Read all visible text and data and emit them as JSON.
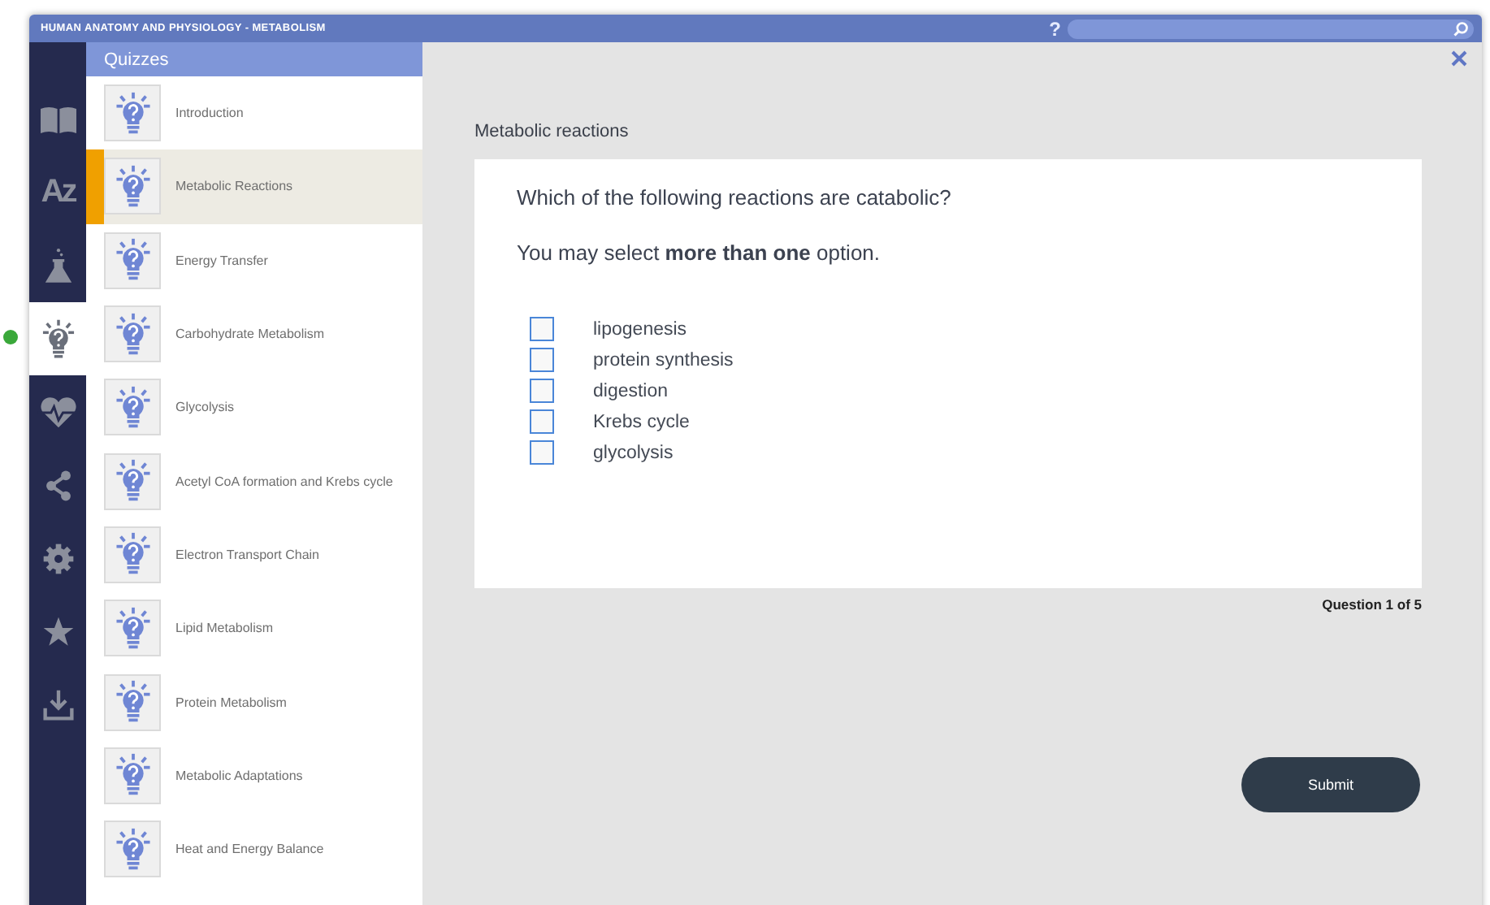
{
  "window": {
    "title": "HUMAN ANATOMY AND PHYSIOLOGY - METABOLISM",
    "help": "?"
  },
  "rail": [
    {
      "kind": "book",
      "selected": false
    },
    {
      "kind": "az",
      "label": "Az",
      "selected": false
    },
    {
      "kind": "flask",
      "selected": false
    },
    {
      "kind": "bulb",
      "selected": true
    },
    {
      "kind": "heart",
      "selected": false
    },
    {
      "kind": "share",
      "selected": false
    },
    {
      "kind": "gear",
      "selected": false
    },
    {
      "kind": "star",
      "selected": false
    },
    {
      "kind": "download",
      "selected": false
    }
  ],
  "sidebar": {
    "title": "Quizzes",
    "items": [
      {
        "label": "Introduction",
        "selected": false
      },
      {
        "label": "Metabolic Reactions",
        "selected": true
      },
      {
        "label": "Energy Transfer",
        "selected": false
      },
      {
        "label": "Carbohydrate Metabolism",
        "selected": false
      },
      {
        "label": "Glycolysis",
        "selected": false
      },
      {
        "label": "Acetyl CoA formation and Krebs cycle",
        "selected": false
      },
      {
        "label": "Electron Transport Chain",
        "selected": false
      },
      {
        "label": "Lipid Metabolism",
        "selected": false
      },
      {
        "label": "Protein Metabolism",
        "selected": false
      },
      {
        "label": "Metabolic Adaptations",
        "selected": false
      },
      {
        "label": "Heat and Energy Balance",
        "selected": false
      }
    ]
  },
  "quiz": {
    "heading": "Metabolic reactions",
    "question": "Which of the following reactions are catabolic?",
    "instruction": "You may select **more than one** option.",
    "options": [
      {
        "label": "lipogenesis",
        "checked": false
      },
      {
        "label": "protein synthesis",
        "checked": false
      },
      {
        "label": "digestion",
        "checked": false
      },
      {
        "label": "Krebs cycle",
        "checked": false
      },
      {
        "label": "glycolysis",
        "checked": false
      }
    ],
    "progress": "Question 1 of 5",
    "submit": "Submit"
  }
}
